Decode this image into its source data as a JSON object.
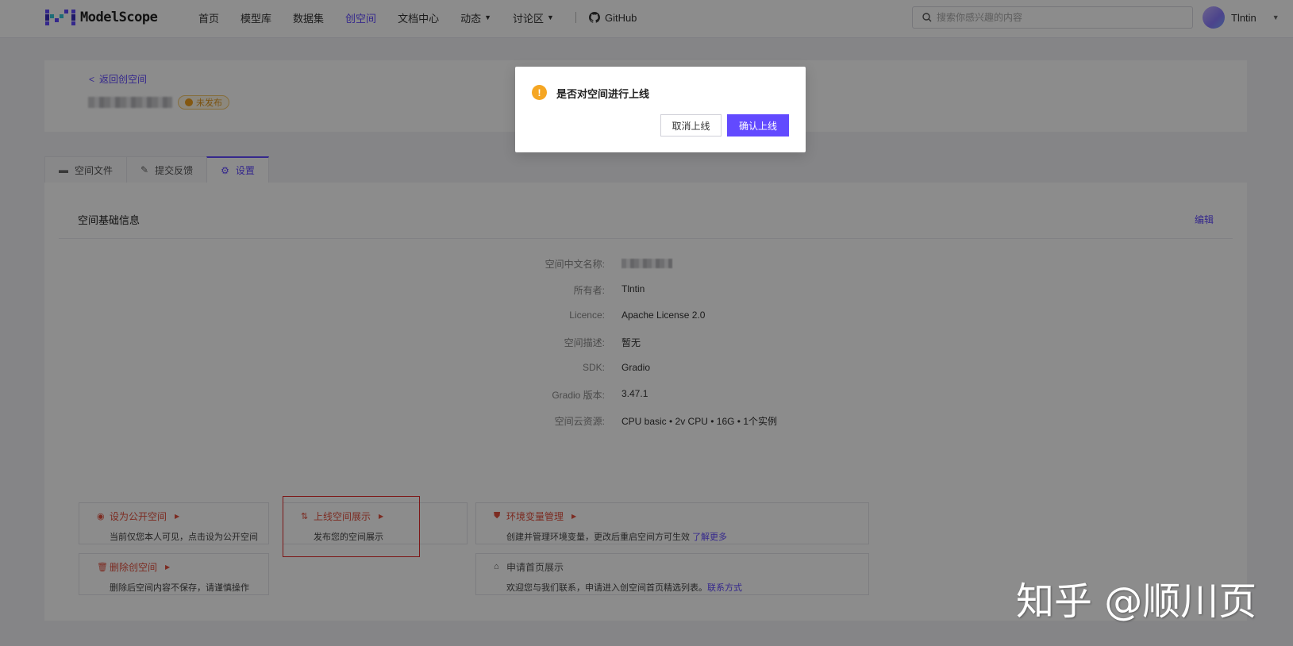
{
  "header": {
    "logo_text": "ModelScope",
    "nav": [
      {
        "label": "首页"
      },
      {
        "label": "模型库"
      },
      {
        "label": "数据集"
      },
      {
        "label": "创空间"
      },
      {
        "label": "文档中心"
      },
      {
        "label": "动态"
      },
      {
        "label": "讨论区"
      },
      {
        "label": "GitHub"
      }
    ],
    "active_nav": "创空间",
    "search_placeholder": "搜索你感兴趣的内容",
    "username": "Tlntin"
  },
  "hero": {
    "back_label": "返回创空间",
    "status": "未发布"
  },
  "tabs": [
    {
      "label": "空间文件"
    },
    {
      "label": "提交反馈"
    },
    {
      "label": "设置"
    }
  ],
  "main": {
    "section_title": "空间基础信息",
    "edit_label": "编辑",
    "info": [
      {
        "label": "空间中文名称:",
        "value": ""
      },
      {
        "label": "所有者:",
        "value": "Tlntin"
      },
      {
        "label": "Licence:",
        "value": "Apache License 2.0"
      },
      {
        "label": "空间描述:",
        "value": "暂无"
      },
      {
        "label": "SDK:",
        "value": "Gradio"
      },
      {
        "label": "Gradio 版本:",
        "value": "3.47.1"
      },
      {
        "label": "空间云资源:",
        "value": "CPU basic • 2v CPU • 16G • 1个实例"
      }
    ]
  },
  "actions": {
    "make_public": {
      "title": "设为公开空间",
      "desc": "当前仅您本人可见，点击设为公开空间"
    },
    "publish": {
      "title": "上线空间展示",
      "desc": "发布您的空间展示"
    },
    "env": {
      "title": "环境变量管理",
      "desc": "创建并管理环境变量，更改后重启空间方可生效",
      "link": "了解更多"
    },
    "delete": {
      "title": "删除创空间",
      "desc": "删除后空间内容不保存，请谨慎操作"
    },
    "homepage": {
      "title": "申请首页展示",
      "desc": "欢迎您与我们联系，申请进入创空间首页精选列表。",
      "link": "联系方式"
    }
  },
  "modal": {
    "title": "是否对空间进行上线",
    "cancel_label": "取消上线",
    "confirm_label": "确认上线"
  },
  "watermark": "知乎 @顺川页",
  "colors": {
    "accent": "#624aff",
    "danger": "#e2503f",
    "warning": "#f5a623"
  }
}
